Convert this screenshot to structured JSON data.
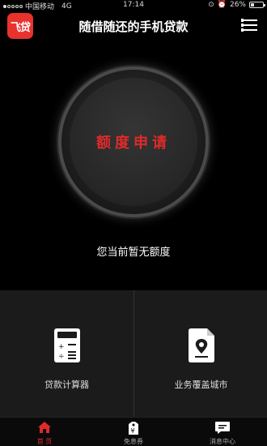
{
  "status_bar": {
    "carrier": "中国移动",
    "network": "4G",
    "time": "17:14",
    "battery": "26%",
    "battery_level": 0.26
  },
  "header": {
    "logo_text": "飞贷",
    "title": "随借随还的手机贷款",
    "menu_icon": "list-menu-icon"
  },
  "hero": {
    "apply_button_label": "额度申请",
    "quota_status": "您当前暂无额度"
  },
  "features": [
    {
      "label": "贷款计算器",
      "icon": "calculator-icon"
    },
    {
      "label": "业务覆盖城市",
      "icon": "location-document-icon"
    }
  ],
  "tabs": [
    {
      "label": "首 页",
      "icon": "home-icon",
      "active": true
    },
    {
      "label": "免息券",
      "icon": "coupon-icon",
      "active": false
    },
    {
      "label": "消息中心",
      "icon": "message-icon",
      "active": false
    }
  ],
  "colors": {
    "accent": "#e02a2a",
    "background": "#000000",
    "panel": "#1b1b1b"
  }
}
